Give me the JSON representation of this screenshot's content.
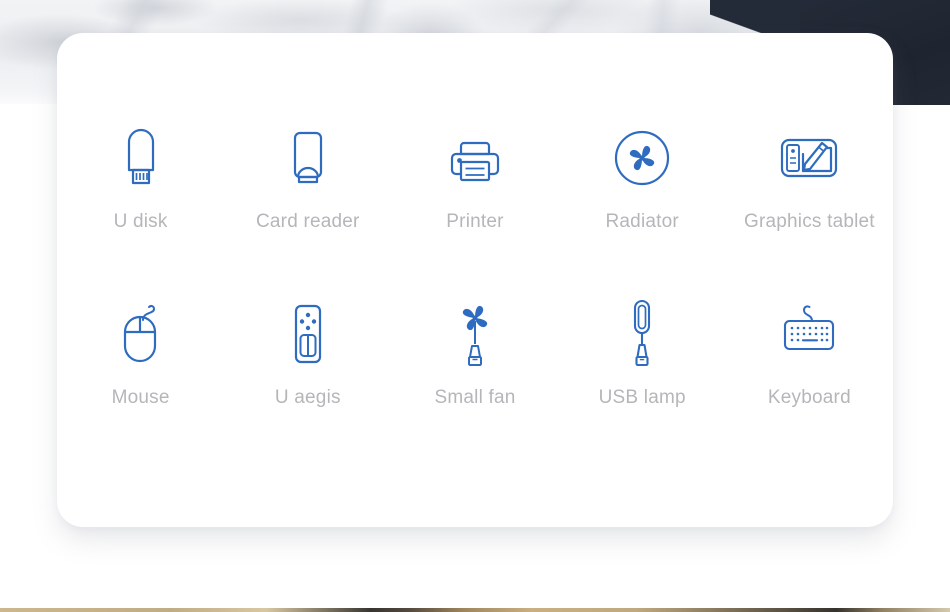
{
  "page": {
    "title": "USB accessories icon grid",
    "card_background": "#ffffff",
    "icon_color": "#2f6cbf",
    "label_color": "#b4b6b9",
    "dark_corner_color": "#242b38",
    "marble_color": "#eceef1"
  },
  "items": [
    {
      "label": "U disk",
      "icon": "u-disk-icon"
    },
    {
      "label": "Card reader",
      "icon": "card-reader-icon"
    },
    {
      "label": "Printer",
      "icon": "printer-icon"
    },
    {
      "label": "Radiator",
      "icon": "radiator-fan-icon"
    },
    {
      "label": "Graphics tablet",
      "icon": "graphics-tablet-icon"
    },
    {
      "label": "Mouse",
      "icon": "mouse-icon"
    },
    {
      "label": "U aegis",
      "icon": "u-aegis-icon"
    },
    {
      "label": "Small fan",
      "icon": "small-fan-icon"
    },
    {
      "label": "USB lamp",
      "icon": "usb-lamp-icon"
    },
    {
      "label": "Keyboard",
      "icon": "keyboard-icon"
    }
  ]
}
